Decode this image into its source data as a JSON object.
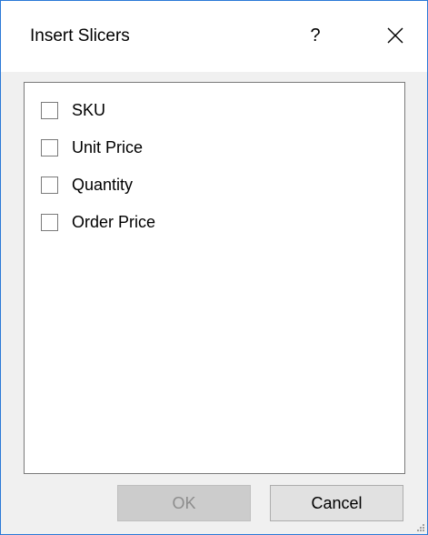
{
  "dialog": {
    "title": "Insert Slicers",
    "help_label": "?",
    "close_icon": "close-icon"
  },
  "fields": [
    {
      "label": "SKU",
      "checked": false
    },
    {
      "label": "Unit Price",
      "checked": false
    },
    {
      "label": "Quantity",
      "checked": false
    },
    {
      "label": "Order Price",
      "checked": false
    }
  ],
  "buttons": {
    "ok_label": "OK",
    "ok_enabled": false,
    "cancel_label": "Cancel"
  },
  "colors": {
    "window_border": "#2b79d7",
    "dialog_background": "#f0f0f0",
    "disabled_text": "#8d8d8d"
  }
}
